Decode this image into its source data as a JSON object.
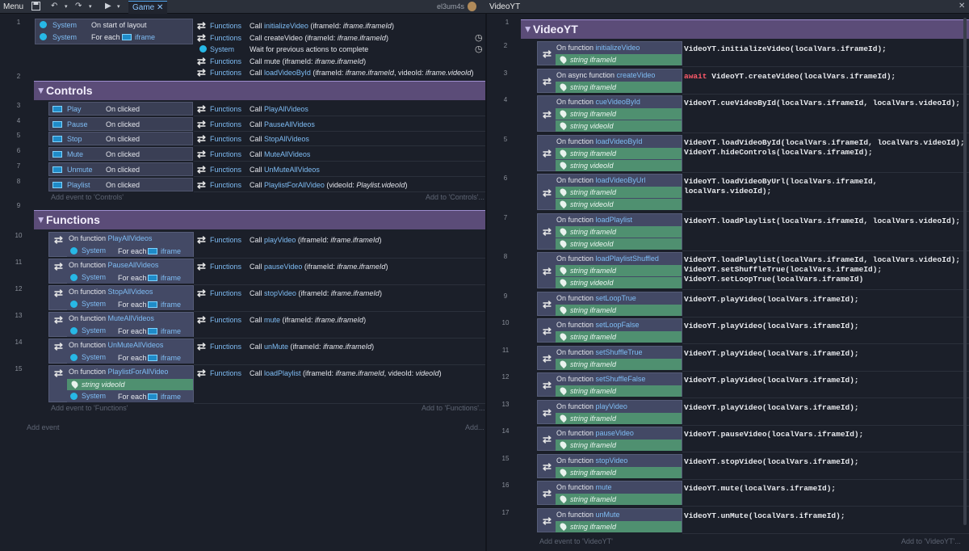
{
  "topbar": {
    "menu": "Menu",
    "tab_game": "Game",
    "close": "✕",
    "user": "el3um4s",
    "tab_videoyt": "VideoYT"
  },
  "left": {
    "event1": {
      "line": "1",
      "rows": [
        {
          "obj": "System",
          "cond": "On start of layout"
        },
        {
          "obj": "System",
          "cond": "For each",
          "target": "iframe"
        }
      ],
      "actions": [
        {
          "obj": "Functions",
          "call": "Call ",
          "fn": "initializeVideo",
          "args_pre": " (iframeId: ",
          "args_it": "iframe.iframeId",
          "args_post": ")"
        },
        {
          "obj": "Functions",
          "call": "Call ",
          "fn": "",
          "args_pre": "createVideo (iframeId: ",
          "args_it": "iframe.iframeId",
          "args_post": ")"
        },
        {
          "obj": "System",
          "call": "Wait for previous actions to complete",
          "fn": "",
          "args_pre": "",
          "args_it": "",
          "args_post": ""
        },
        {
          "obj": "Functions",
          "call": "Call ",
          "fn": "",
          "args_pre": "mute (iframeId: ",
          "args_it": "iframe.iframeId",
          "args_post": ")"
        },
        {
          "obj": "Functions",
          "call": "Call ",
          "fn": "loadVideoById",
          "args_pre": " (iframeId: ",
          "args_it": "iframe.iframeId",
          "args_post": ", videoId: ",
          "args_it2": "iframe.videoId",
          "args_post2": ")"
        }
      ]
    },
    "group_controls": {
      "line": "2",
      "title": "Controls"
    },
    "controls": [
      {
        "line": "3",
        "obj": "Play",
        "cond": "On clicked",
        "fn": "PlayAllVideos",
        "extra": ""
      },
      {
        "line": "4",
        "obj": "Pause",
        "cond": "On clicked",
        "fn": "PauseAllVideos",
        "extra": ""
      },
      {
        "line": "5",
        "obj": "Stop",
        "cond": "On clicked",
        "fn": "StopAllVideos",
        "extra": ""
      },
      {
        "line": "6",
        "obj": "Mute",
        "cond": "On clicked",
        "fn": "MuteAllVideos",
        "extra": ""
      },
      {
        "line": "7",
        "obj": "Unmute",
        "cond": "On clicked",
        "fn": "UnMuteAllVideos",
        "extra": ""
      },
      {
        "line": "8",
        "obj": "Playlist",
        "cond": "On clicked",
        "fn": "PlaylistForAllVideo",
        "extra": " (videoId: ",
        "extra_it": "Playlist.videoId",
        "extra_post": ")"
      }
    ],
    "controls_footer": {
      "add_event": "Add event to 'Controls'",
      "add_to": "Add to 'Controls'..."
    },
    "group_functions": {
      "line": "9",
      "title": "Functions"
    },
    "functions": [
      {
        "line": "10",
        "name": "PlayAllVideos",
        "call": "playVideo"
      },
      {
        "line": "11",
        "name": "PauseAllVideos",
        "call": "pauseVideo"
      },
      {
        "line": "12",
        "name": "StopAllVideos",
        "call": "stopVideo"
      },
      {
        "line": "13",
        "name": "MuteAllVideos",
        "call": "mute"
      },
      {
        "line": "14",
        "name": "UnMuteAllVideos",
        "call": "unMute"
      },
      {
        "line": "15",
        "name": "PlaylistForAllVideo",
        "call": "loadPlaylist"
      }
    ],
    "fn_labels": {
      "on_function": "On function ",
      "system": "System",
      "for_each": "For each",
      "iframe": "iframe",
      "functions": "Functions",
      "call": "Call ",
      "args_pre": " (iframeId: ",
      "args_it": "iframe.iframeId",
      "args_post": ")",
      "pl_mid": ", videoId: ",
      "pl_it2": "videoId",
      "string_videoid": "string videoId"
    },
    "functions_footer": {
      "add_event": "Add event to 'Functions'",
      "add_to": "Add to 'Functions'..."
    },
    "root_footer": {
      "add_event": "Add event",
      "add_to": "Add..."
    }
  },
  "right": {
    "group": {
      "line": "1",
      "title": "VideoYT"
    },
    "labels": {
      "on_function": "On function ",
      "on_async": "On async function ",
      "string_iframeid": "string iframeId",
      "string_videoid": "string videoId"
    },
    "events": [
      {
        "line": "2",
        "async": false,
        "name": "initializeVideo",
        "params": [
          "iframeId"
        ],
        "code": [
          "VideoYT.initializeVideo(localVars.iframeId);"
        ]
      },
      {
        "line": "3",
        "async": true,
        "name": "createVideo",
        "params": [
          "iframeId"
        ],
        "code": [
          "await VideoYT.createVideo(localVars.iframeId);"
        ]
      },
      {
        "line": "4",
        "async": false,
        "name": "cueVideoById",
        "params": [
          "iframeId",
          "videoId"
        ],
        "code": [
          "VideoYT.cueVideoById(localVars.iframeId, localVars.videoId);"
        ]
      },
      {
        "line": "5",
        "async": false,
        "name": "loadVideoById",
        "params": [
          "iframeId",
          "videoId"
        ],
        "code": [
          "VideoYT.loadVideoById(localVars.iframeId, localVars.videoId);",
          "VideoYT.hideControls(localVars.iframeId);"
        ]
      },
      {
        "line": "6",
        "async": false,
        "name": "loadVideoByUrl",
        "params": [
          "iframeId",
          "videoId"
        ],
        "code": [
          "VideoYT.loadVideoByUrl(localVars.iframeId,",
          "localVars.videoId);"
        ]
      },
      {
        "line": "7",
        "async": false,
        "name": "loadPlaylist",
        "params": [
          "iframeId",
          "videoId"
        ],
        "code": [
          "VideoYT.loadPlaylist(localVars.iframeId, localVars.videoId);"
        ]
      },
      {
        "line": "8",
        "async": false,
        "name": "loadPlaylistShuffled",
        "params": [
          "iframeId",
          "videoId"
        ],
        "code": [
          "VideoYT.loadPlaylist(localVars.iframeId, localVars.videoId);",
          "VideoYT.setShuffleTrue(localVars.iframeId);",
          "VideoYT.setLoopTrue(localVars.iframeId)"
        ]
      },
      {
        "line": "9",
        "async": false,
        "name": "setLoopTrue",
        "params": [
          "iframeId"
        ],
        "code": [
          "VideoYT.playVideo(localVars.iframeId);"
        ]
      },
      {
        "line": "10",
        "async": false,
        "name": "setLoopFalse",
        "params": [
          "iframeId"
        ],
        "code": [
          "VideoYT.playVideo(localVars.iframeId);"
        ]
      },
      {
        "line": "11",
        "async": false,
        "name": "setShuffleTrue",
        "params": [
          "iframeId"
        ],
        "code": [
          "VideoYT.playVideo(localVars.iframeId);"
        ]
      },
      {
        "line": "12",
        "async": false,
        "name": "setShuffleFalse",
        "params": [
          "iframeId"
        ],
        "code": [
          "VideoYT.playVideo(localVars.iframeId);"
        ]
      },
      {
        "line": "13",
        "async": false,
        "name": "playVideo",
        "params": [
          "iframeId"
        ],
        "code": [
          "VideoYT.playVideo(localVars.iframeId);"
        ]
      },
      {
        "line": "14",
        "async": false,
        "name": "pauseVideo",
        "params": [
          "iframeId"
        ],
        "code": [
          "VideoYT.pauseVideo(localVars.iframeId);"
        ]
      },
      {
        "line": "15",
        "async": false,
        "name": "stopVideo",
        "params": [
          "iframeId"
        ],
        "code": [
          "VideoYT.stopVideo(localVars.iframeId);"
        ]
      },
      {
        "line": "16",
        "async": false,
        "name": "mute",
        "params": [
          "iframeId"
        ],
        "code": [
          "VideoYT.mute(localVars.iframeId);"
        ]
      },
      {
        "line": "17",
        "async": false,
        "name": "unMute",
        "params": [
          "iframeId"
        ],
        "code": [
          "VideoYT.unMute(localVars.iframeId);"
        ]
      }
    ],
    "footer": {
      "add_event": "Add event to 'VideoYT'",
      "add_to": "Add to 'VideoYT'..."
    }
  }
}
